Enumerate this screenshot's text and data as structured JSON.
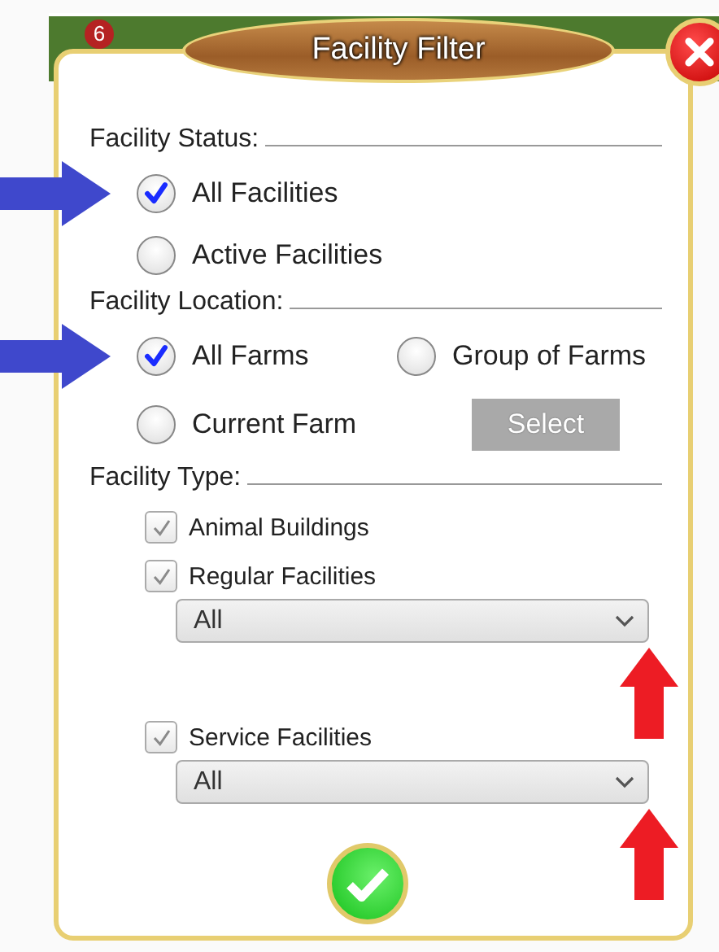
{
  "background": {
    "badge": "6"
  },
  "dialog": {
    "title": "Facility Filter",
    "status": {
      "heading": "Facility Status:",
      "options": [
        {
          "label": "All Facilities",
          "selected": true
        },
        {
          "label": "Active Facilities",
          "selected": false
        }
      ]
    },
    "location": {
      "heading": "Facility Location:",
      "options": [
        {
          "label": "All Farms",
          "selected": true
        },
        {
          "label": "Group of Farms",
          "selected": false
        },
        {
          "label": "Current Farm",
          "selected": false
        }
      ],
      "select_button": {
        "label": "Select",
        "disabled": true
      }
    },
    "type": {
      "heading": "Facility Type:",
      "items": [
        {
          "label": "Animal Buildings",
          "checked": true
        },
        {
          "label": "Regular Facilities",
          "checked": true,
          "dropdown": {
            "value": "All"
          }
        },
        {
          "label": "Service Facilities",
          "checked": true,
          "dropdown": {
            "value": "All"
          }
        }
      ]
    }
  },
  "annotations": [
    {
      "kind": "right",
      "color": "#3f48cc"
    },
    {
      "kind": "right",
      "color": "#3f48cc"
    },
    {
      "kind": "up",
      "color": "#ed1c24"
    },
    {
      "kind": "up",
      "color": "#ed1c24"
    }
  ]
}
